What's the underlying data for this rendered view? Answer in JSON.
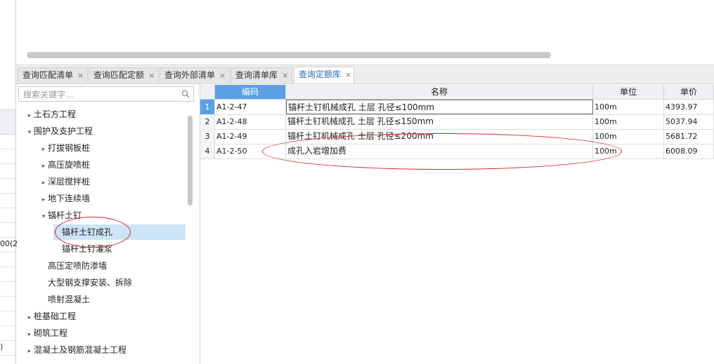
{
  "left_strip": {
    "cut_texts": [
      "00(2",
      ")"
    ]
  },
  "tabs": [
    {
      "label": "查询匹配清单",
      "close": "×",
      "active": false
    },
    {
      "label": "查询匹配定额",
      "close": "×",
      "active": false
    },
    {
      "label": "查询外部清单",
      "close": "×",
      "active": false
    },
    {
      "label": "查询清单库",
      "close": "×",
      "active": false
    },
    {
      "label": "查询定额库",
      "close": "×",
      "active": true
    }
  ],
  "search": {
    "placeholder": "搜索关键字...",
    "icon": "search-icon"
  },
  "tree": [
    {
      "label": "土石方工程",
      "level": 0,
      "arrow": "▸"
    },
    {
      "label": "围护及支护工程",
      "level": 0,
      "arrow": "▾"
    },
    {
      "label": "打拔钢板桩",
      "level": 1,
      "arrow": "▸"
    },
    {
      "label": "高压旋喷桩",
      "level": 1,
      "arrow": "▸"
    },
    {
      "label": "深层搅拌桩",
      "level": 1,
      "arrow": "▸"
    },
    {
      "label": "地下连续墙",
      "level": 1,
      "arrow": "▸"
    },
    {
      "label": "锚杆土钉",
      "level": 1,
      "arrow": "▾"
    },
    {
      "label": "锚杆土钉成孔",
      "level": 2,
      "arrow": "",
      "selected": true
    },
    {
      "label": "锚杆土钉灌浆",
      "level": 2,
      "arrow": ""
    },
    {
      "label": "高压定喷防渗墙",
      "level": 1,
      "arrow": ""
    },
    {
      "label": "大型钢支撑安装、拆除",
      "level": 1,
      "arrow": ""
    },
    {
      "label": "喷射混凝土",
      "level": 1,
      "arrow": ""
    },
    {
      "label": "桩基础工程",
      "level": 0,
      "arrow": "▸"
    },
    {
      "label": "砌筑工程",
      "level": 0,
      "arrow": "▸"
    },
    {
      "label": "混凝土及钢筋混凝土工程",
      "level": 0,
      "arrow": "▸"
    }
  ],
  "table": {
    "columns": [
      "编码",
      "名称",
      "单位",
      "单价"
    ],
    "rows": [
      {
        "index": "1",
        "code": "A1-2-47",
        "name": "锚杆土钉机械成孔 土层 孔径≤100mm",
        "unit": "100m",
        "price": "4393.97"
      },
      {
        "index": "2",
        "code": "A1-2-48",
        "name": "锚杆土钉机械成孔 土层 孔径≤150mm",
        "unit": "100m",
        "price": "5037.94"
      },
      {
        "index": "3",
        "code": "A1-2-49",
        "name": "锚杆土钉机械成孔 土层 孔径≤200mm",
        "unit": "100m",
        "price": "5681.72"
      },
      {
        "index": "4",
        "code": "A1-2-50",
        "name": "成孔入岩增加费",
        "unit": "100m",
        "price": "6008.09"
      }
    ]
  },
  "colors": {
    "accent": "#5aa0e2",
    "selection": "#cce4f7",
    "annotation": "#d9282a",
    "active_tab_text": "#2a6fbd"
  }
}
